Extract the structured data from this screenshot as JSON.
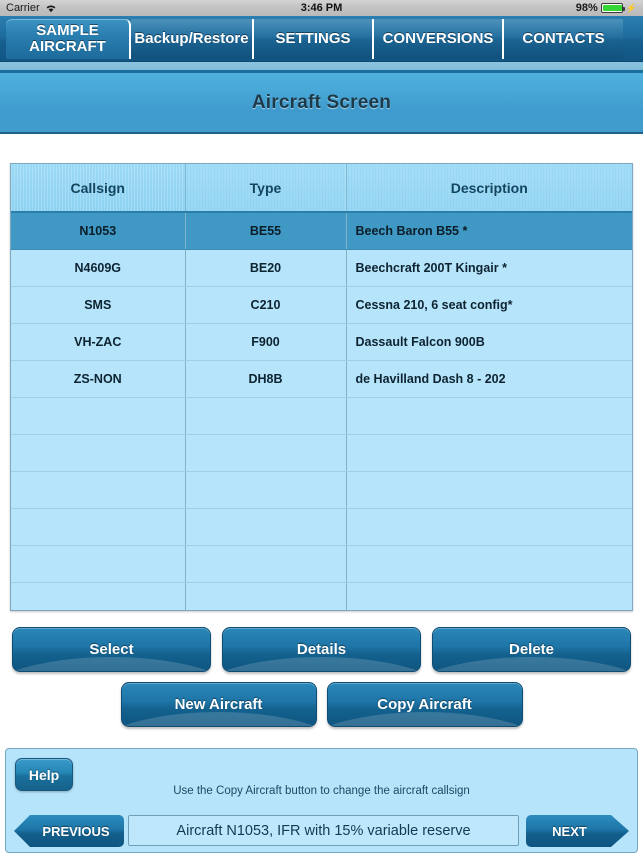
{
  "statusbar": {
    "carrier": "Carrier",
    "wifi_icon": "wifi-icon",
    "time": "3:46 PM",
    "battery_percent": "98%",
    "battery_level": 98,
    "charging_icon": "lightning-bolt-icon"
  },
  "tabs": [
    {
      "label": "SAMPLE AIRCRAFT",
      "selected": true
    },
    {
      "label": "Backup/Restore",
      "selected": false
    },
    {
      "label": "SETTINGS",
      "selected": false
    },
    {
      "label": "CONVERSIONS",
      "selected": false
    },
    {
      "label": "CONTACTS",
      "selected": false
    }
  ],
  "header": {
    "title": "Aircraft Screen"
  },
  "table": {
    "columns": [
      "Callsign",
      "Type",
      "Description"
    ],
    "rows": [
      {
        "callsign": "N1053",
        "type": "BE55",
        "description": "Beech Baron B55 *",
        "selected": true
      },
      {
        "callsign": "N4609G",
        "type": "BE20",
        "description": "Beechcraft 200T Kingair *",
        "selected": false
      },
      {
        "callsign": "SMS",
        "type": "C210",
        "description": "Cessna 210, 6 seat config*",
        "selected": false
      },
      {
        "callsign": "VH-ZAC",
        "type": "F900",
        "description": "Dassault Falcon 900B",
        "selected": false
      },
      {
        "callsign": "ZS-NON",
        "type": "DH8B",
        "description": "de Havilland Dash 8 - 202",
        "selected": false
      }
    ],
    "empty_row_count": 6
  },
  "actions": {
    "select": "Select",
    "details": "Details",
    "delete": "Delete",
    "new_aircraft": "New Aircraft",
    "copy_aircraft": "Copy Aircraft"
  },
  "bottom": {
    "help": "Help",
    "hint": "Use the Copy Aircraft button to change the aircraft callsign",
    "previous": "PREVIOUS",
    "next": "NEXT",
    "status_value": "Aircraft N1053, IFR with 15% variable reserve"
  },
  "colors": {
    "accent_blue": "#1e76a8",
    "table_fill": "#b6e4fb",
    "table_header": "#8ed2f2",
    "selected_row": "#4098c4",
    "title_bar": "#47a6d6",
    "battery_green": "#33d633"
  }
}
